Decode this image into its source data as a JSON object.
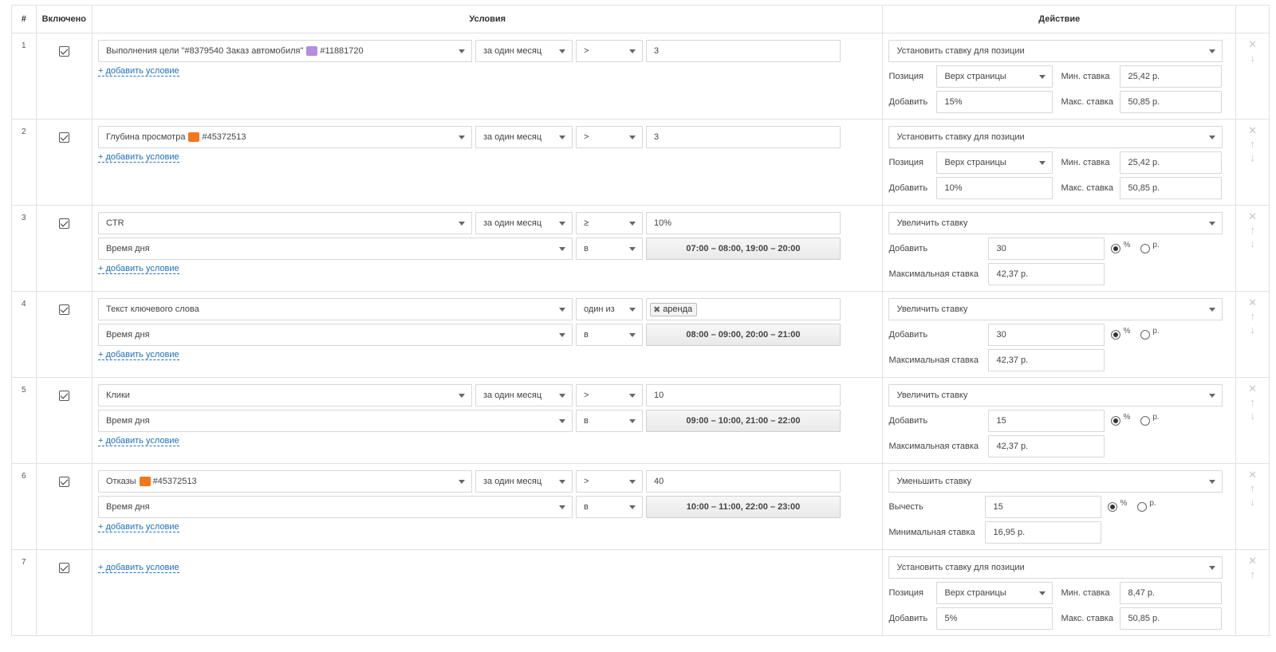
{
  "headers": {
    "num": "#",
    "enabled": "Включено",
    "conditions": "Условия",
    "action": "Действие"
  },
  "add_condition_label": "+ добавить условие",
  "colors": {
    "link": "#1f6fbd",
    "goal_icon": "#b48ce0",
    "metric_icon": "#f3761d"
  },
  "icons": {
    "delete": "cross-icon",
    "up": "arrow-up-icon",
    "down": "arrow-down-icon"
  },
  "rules": [
    {
      "num": "1",
      "c1": {
        "metric": "Выполнения цели \"#8379540 Заказ автомобиля\"",
        "metric_id": "#11881720",
        "period": "за один месяц",
        "op": ">",
        "value": "3"
      },
      "action": {
        "type": "Установить ставку для позиции",
        "pos_label": "Позиция",
        "pos_value": "Верх страницы",
        "add_label": "Добавить",
        "add_value": "15%",
        "min_label": "Мин. ставка",
        "min_value": "25,42 р.",
        "max_label": "Макс. ставка",
        "max_value": "50,85 р."
      }
    },
    {
      "num": "2",
      "c1": {
        "metric": "Глубина просмотра",
        "metric_id": "#45372513",
        "period": "за один месяц",
        "op": ">",
        "value": "3"
      },
      "action": {
        "type": "Установить ставку для позиции",
        "pos_label": "Позиция",
        "pos_value": "Верх страницы",
        "add_label": "Добавить",
        "add_value": "10%",
        "min_label": "Мин. ставка",
        "min_value": "25,42 р.",
        "max_label": "Макс. ставка",
        "max_value": "50,85 р."
      }
    },
    {
      "num": "3",
      "c1": {
        "metric": "CTR",
        "period": "за один месяц",
        "op": "≥",
        "value": "10%"
      },
      "c2": {
        "metric": "Время дня",
        "op": "в",
        "value": "07:00 – 08:00, 19:00 – 20:00"
      },
      "action": {
        "type": "Увеличить ставку",
        "add_label": "Добавить",
        "add_value": "30",
        "unit_percent": "%",
        "unit_rub": "р.",
        "limit_label": "Максимальная ставка",
        "limit_value": "42,37 р."
      }
    },
    {
      "num": "4",
      "c1": {
        "metric": "Текст ключевого слова",
        "op": "один из",
        "tag": "аренда"
      },
      "c2": {
        "metric": "Время дня",
        "op": "в",
        "value": "08:00 – 09:00, 20:00 – 21:00"
      },
      "action": {
        "type": "Увеличить ставку",
        "add_label": "Добавить",
        "add_value": "30",
        "unit_percent": "%",
        "unit_rub": "р.",
        "limit_label": "Максимальная ставка",
        "limit_value": "42,37 р."
      }
    },
    {
      "num": "5",
      "c1": {
        "metric": "Клики",
        "period": "за один месяц",
        "op": ">",
        "value": "10"
      },
      "c2": {
        "metric": "Время дня",
        "op": "в",
        "value": "09:00 – 10:00, 21:00 – 22:00"
      },
      "action": {
        "type": "Увеличить ставку",
        "add_label": "Добавить",
        "add_value": "15",
        "unit_percent": "%",
        "unit_rub": "р.",
        "limit_label": "Максимальная ставка",
        "limit_value": "42,37 р."
      }
    },
    {
      "num": "6",
      "c1": {
        "metric": "Отказы",
        "metric_id": "#45372513",
        "period": "за один месяц",
        "op": ">",
        "value": "40"
      },
      "c2": {
        "metric": "Время дня",
        "op": "в",
        "value": "10:00 – 11:00, 22:00 – 23:00"
      },
      "action": {
        "type": "Уменьшить ставку",
        "add_label": "Вычесть",
        "add_value": "15",
        "unit_percent": "%",
        "unit_rub": "р.",
        "limit_label": "Минимальная ставка",
        "limit_value": "16,95 р."
      }
    },
    {
      "num": "7",
      "action": {
        "type": "Установить ставку для позиции",
        "pos_label": "Позиция",
        "pos_value": "Верх страницы",
        "add_label": "Добавить",
        "add_value": "5%",
        "min_label": "Мин. ставка",
        "min_value": "8,47 р.",
        "max_label": "Макс. ставка",
        "max_value": "50,85 р."
      }
    }
  ]
}
